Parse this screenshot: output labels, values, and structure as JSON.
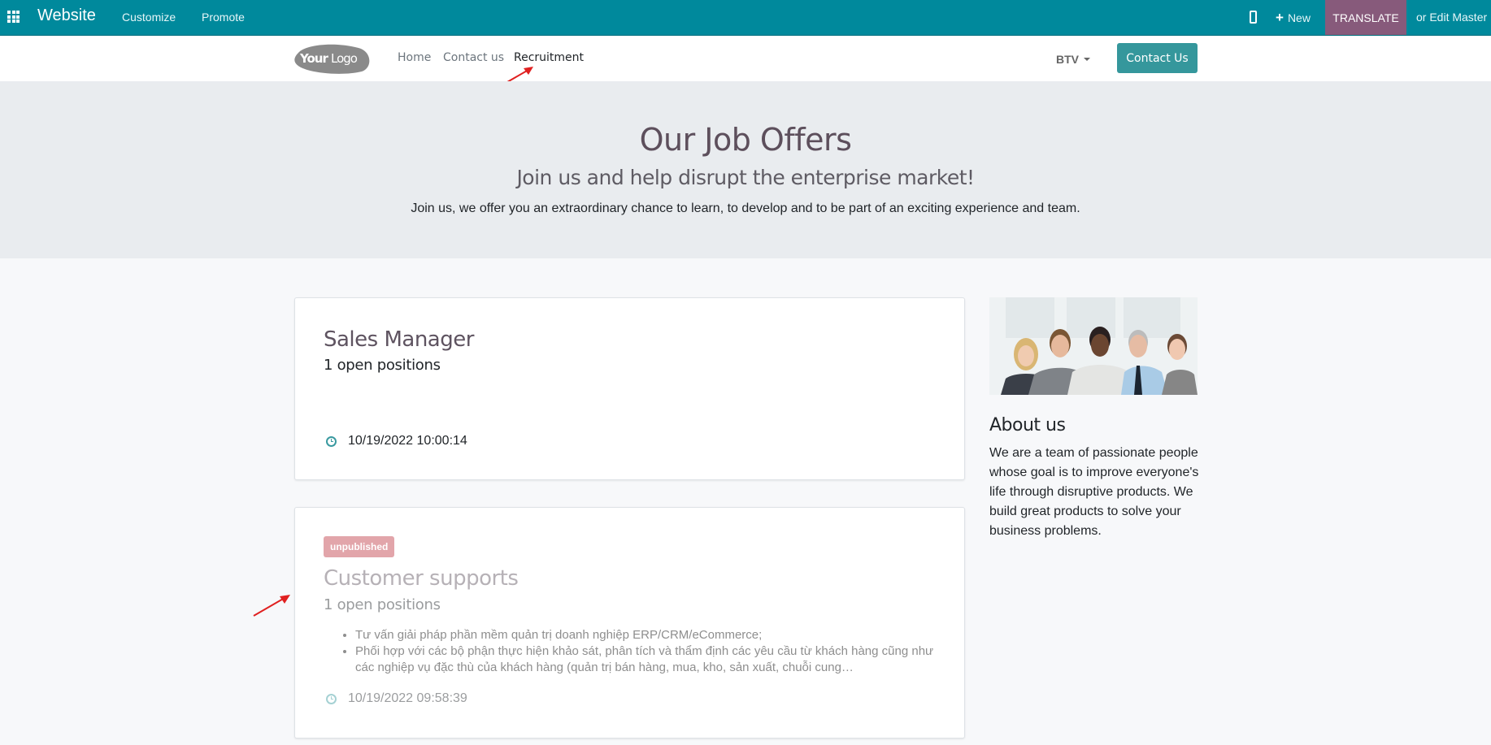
{
  "adminbar": {
    "brand": "Website",
    "menu": [
      {
        "label": "Customize"
      },
      {
        "label": "Promote"
      }
    ],
    "new_label": "New",
    "translate_label": "TRANSLATE",
    "edit_master_label": "or Edit Master",
    "colors": {
      "bar": "#00899c",
      "translate": "#875a7b"
    }
  },
  "header": {
    "logo_text_bold": "Your",
    "logo_text_light": "Logo",
    "nav": [
      {
        "label": "Home",
        "active": false
      },
      {
        "label": "Contact us",
        "active": false
      },
      {
        "label": "Recruitment",
        "active": true
      }
    ],
    "language": "BTV",
    "cta_label": "Contact Us"
  },
  "hero": {
    "title": "Our Job Offers",
    "subtitle": "Join us and help disrupt the enterprise market!",
    "text": "Join us, we offer you an extraordinary chance to learn, to develop and to be part of an exciting experience and team."
  },
  "jobs": [
    {
      "title": "Sales Manager",
      "open_positions": "1 open positions",
      "published": true,
      "date": "10/19/2022 10:00:14"
    },
    {
      "badge": "unpublished",
      "title": "Customer supports",
      "open_positions": "1 open positions",
      "published": false,
      "description": [
        "Tư vấn giải pháp phần mềm quản trị doanh nghiệp ERP/CRM/eCommerce;",
        "Phối hợp với các bộ phận thực hiện khảo sát, phân tích và thẩm định các yêu cầu từ khách hàng cũng như các nghiệp vụ đặc thù của khách hàng (quản trị bán hàng, mua, kho, sản xuất, chuỗi cung…"
      ],
      "date": "10/19/2022 09:58:39"
    }
  ],
  "sidebar": {
    "image_alt": "team photo",
    "about_title": "About us",
    "about_text": "We are a team of passionate people whose goal is to improve everyone's life through disruptive products. We build great products to solve your business problems."
  }
}
